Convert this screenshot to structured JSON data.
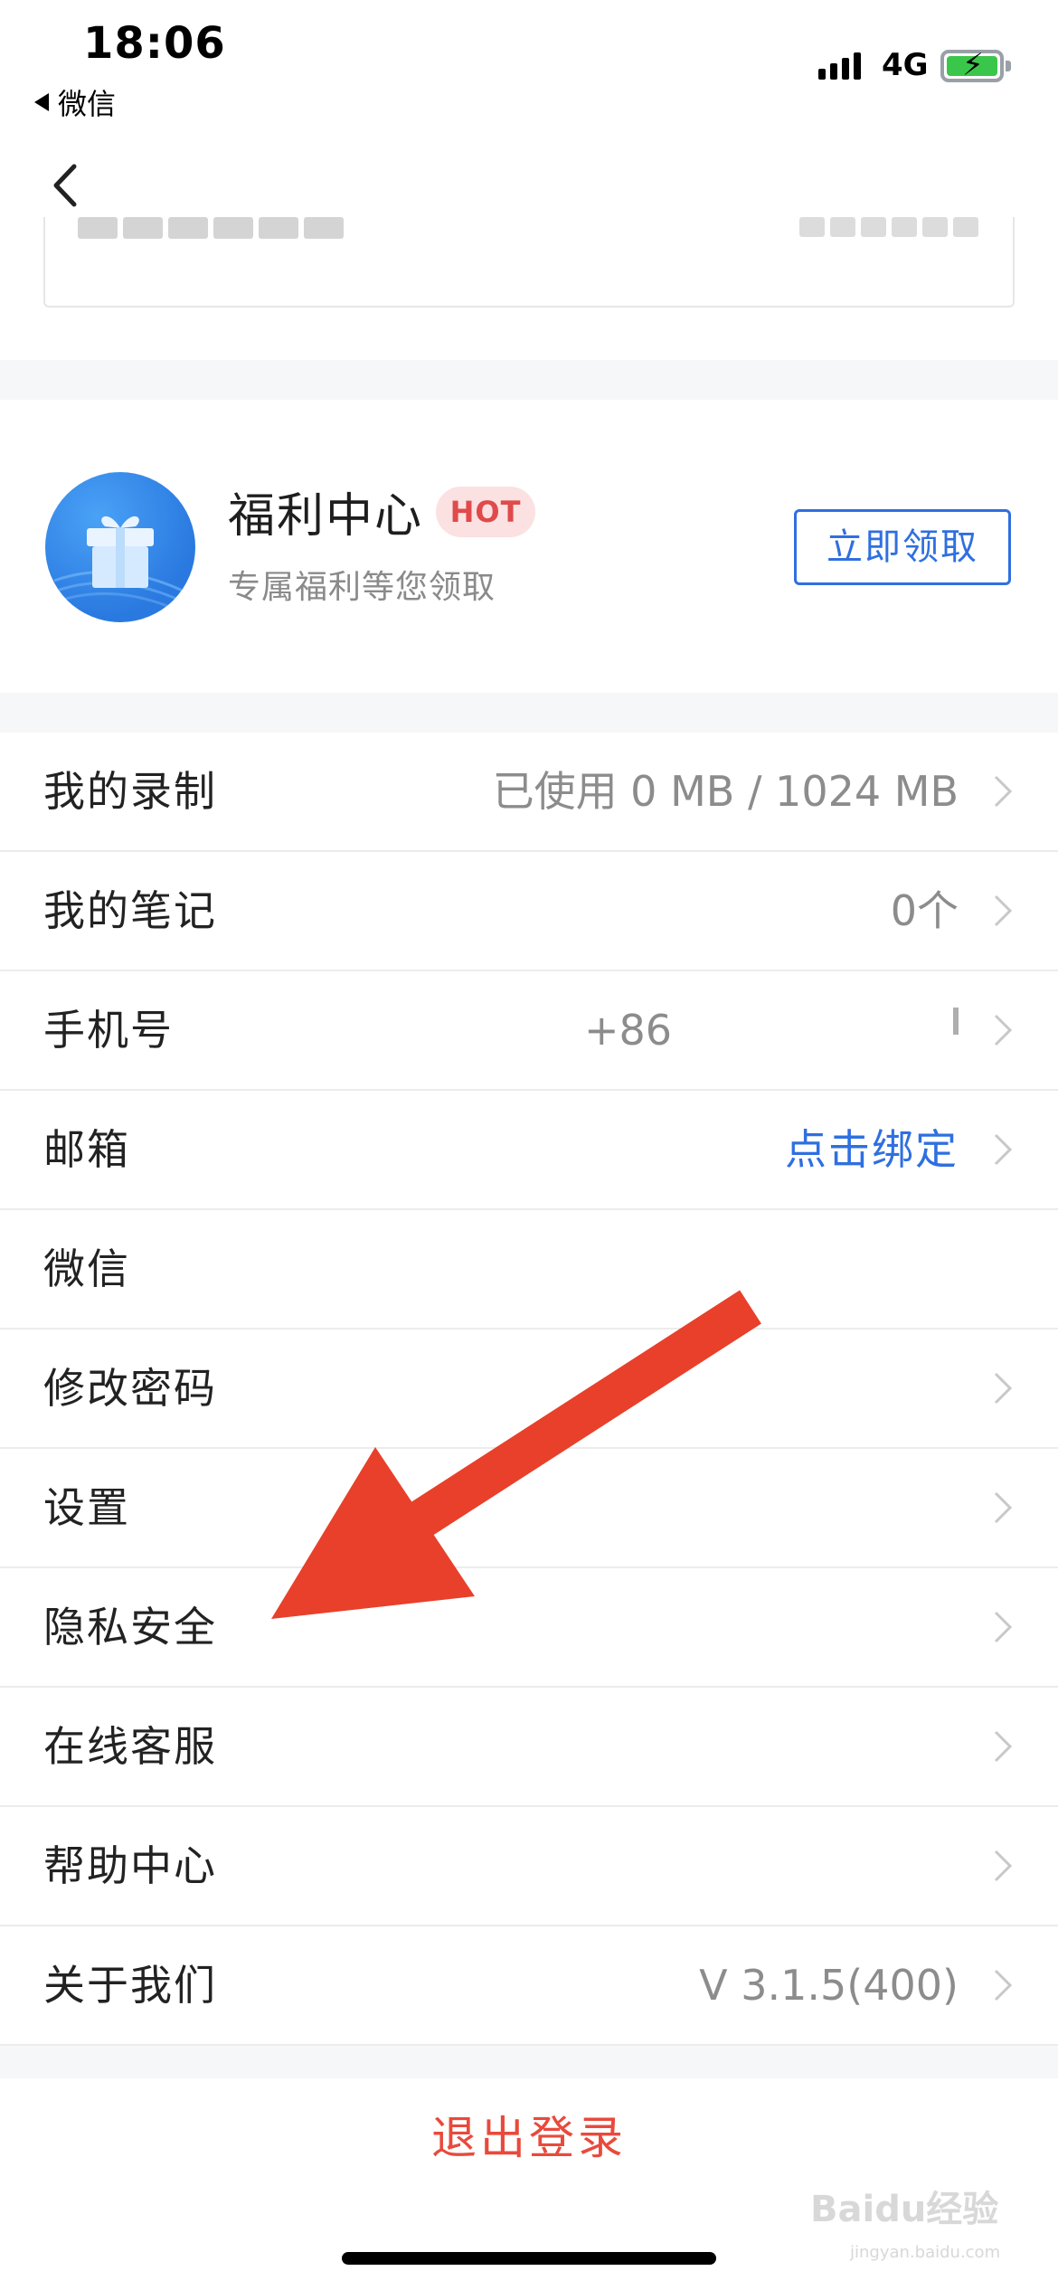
{
  "status_bar": {
    "time": "18:06",
    "back_app": "微信",
    "network": "4G"
  },
  "welfare": {
    "title": "福利中心",
    "badge": "HOT",
    "subtitle": "专属福利等您领取",
    "button": "立即领取"
  },
  "list": {
    "recording": {
      "label": "我的录制",
      "value": "已使用 0 MB / 1024 MB"
    },
    "notes": {
      "label": "我的笔记",
      "value": "0个"
    },
    "phone": {
      "label": "手机号",
      "value": "+86"
    },
    "email": {
      "label": "邮箱",
      "value": "点击绑定"
    },
    "wechat": {
      "label": "微信"
    },
    "password": {
      "label": "修改密码"
    },
    "settings": {
      "label": "设置"
    },
    "privacy": {
      "label": "隐私安全"
    },
    "support": {
      "label": "在线客服"
    },
    "help": {
      "label": "帮助中心"
    },
    "about": {
      "label": "关于我们",
      "value": "V 3.1.5(400)"
    }
  },
  "logout": "退出登录",
  "watermark": {
    "brand": "Baidu经验",
    "domain": "jingyan.baidu.com"
  },
  "colors": {
    "accent": "#2f6fe0",
    "danger": "#e84a3c",
    "annotation_arrow": "#e8402a"
  }
}
